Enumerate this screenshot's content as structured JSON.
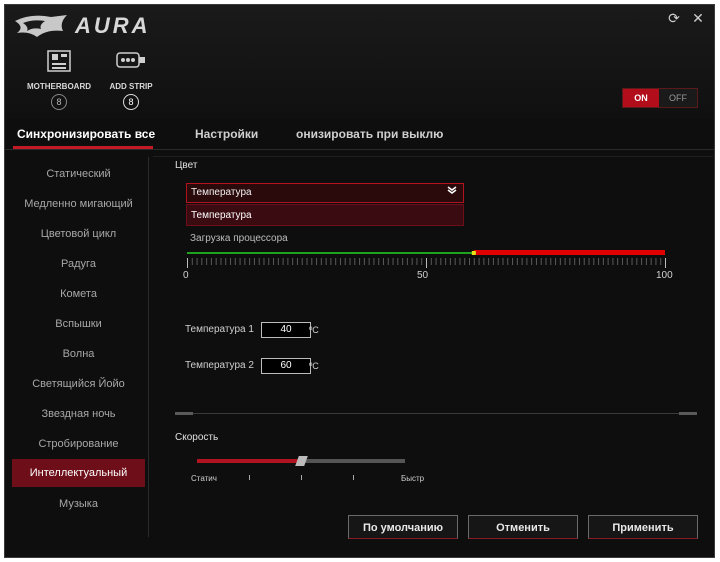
{
  "app": {
    "logo_text": "AURA",
    "brand_red": "#c31a25"
  },
  "window_controls": [
    {
      "icon": "refresh-icon",
      "glyph": "⟳"
    },
    {
      "icon": "close-icon",
      "glyph": "✕"
    }
  ],
  "devices": [
    {
      "label": "MOTHERBOARD",
      "badge": "8",
      "icon": "motherboard-icon"
    },
    {
      "label": "ADD STRIP",
      "badge": "8",
      "icon": "led-strip-icon"
    }
  ],
  "power_toggle": {
    "on_label": "ON",
    "off_label": "OFF",
    "state": "on"
  },
  "tabs": [
    {
      "label": "Синхронизировать все",
      "active": true
    },
    {
      "label": "Настройки",
      "active": false
    },
    {
      "label": "онизировать при выклю",
      "active": false
    }
  ],
  "sidebar": {
    "items": [
      {
        "label": "Статический",
        "active": false
      },
      {
        "label": "Медленно мигающий",
        "active": false
      },
      {
        "label": "Цветовой цикл",
        "active": false
      },
      {
        "label": "Радуга",
        "active": false
      },
      {
        "label": "Комета",
        "active": false
      },
      {
        "label": "Вспышки",
        "active": false
      },
      {
        "label": "Волна",
        "active": false
      },
      {
        "label": "Светящийся Йойо",
        "active": false
      },
      {
        "label": "Звездная ночь",
        "active": false
      },
      {
        "label": "Стробирование",
        "active": false
      },
      {
        "label": "Интеллектуальный",
        "active": true
      },
      {
        "label": "Музыка",
        "active": false
      }
    ]
  },
  "color_section": {
    "label": "Цвет",
    "dropdown": {
      "selected": "Температура",
      "options": [
        "Температура",
        "Загрузка процессора"
      ]
    }
  },
  "scale": {
    "ticks": [
      "0",
      "50",
      "100"
    ],
    "min": 0,
    "max": 100,
    "green_end": 40,
    "red_start": 60,
    "colors": {
      "low": "#1fa31f",
      "high": "#e00000",
      "marker": "#e4e416"
    }
  },
  "temperatures": [
    {
      "label": "Температура 1",
      "value": "40",
      "unit": "ºC"
    },
    {
      "label": "Температура 2",
      "value": "60",
      "unit": "ºC"
    }
  ],
  "speed": {
    "label": "Скорость",
    "min_label": "Статич",
    "max_label": "Быстр",
    "value": 0.5
  },
  "buttons": {
    "default": "По умолчанию",
    "cancel": "Отменить",
    "apply": "Применить"
  }
}
